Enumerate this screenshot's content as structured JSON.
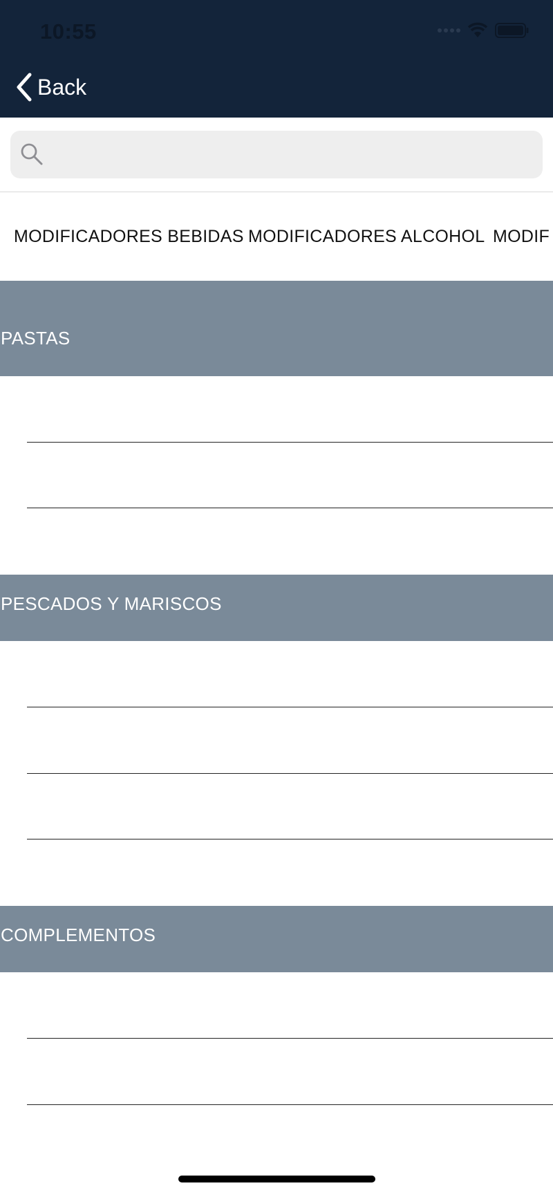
{
  "status_bar": {
    "time": "10:55",
    "icons": [
      "cellular-signal-icon",
      "wifi-icon",
      "battery-icon"
    ]
  },
  "nav": {
    "back_label": "Back",
    "back_icon": "chevron-left-icon"
  },
  "search": {
    "value": "",
    "placeholder": "",
    "icon": "search-icon"
  },
  "categories": [
    "MODIFICADORES BEBIDAS",
    "MODIFICADORES ALCOHOL",
    "MODIF"
  ],
  "sections": [
    {
      "title": "PASTAS",
      "rows": [
        "",
        "",
        ""
      ]
    },
    {
      "title": "PESCADOS Y MARISCOS",
      "rows": [
        "",
        "",
        "",
        ""
      ]
    },
    {
      "title": "COMPLEMENTOS",
      "rows": [
        "",
        "",
        ""
      ]
    }
  ],
  "colors": {
    "nav_background": "#13243a",
    "section_header": "#7a8a99",
    "search_background": "#eeeeee"
  }
}
